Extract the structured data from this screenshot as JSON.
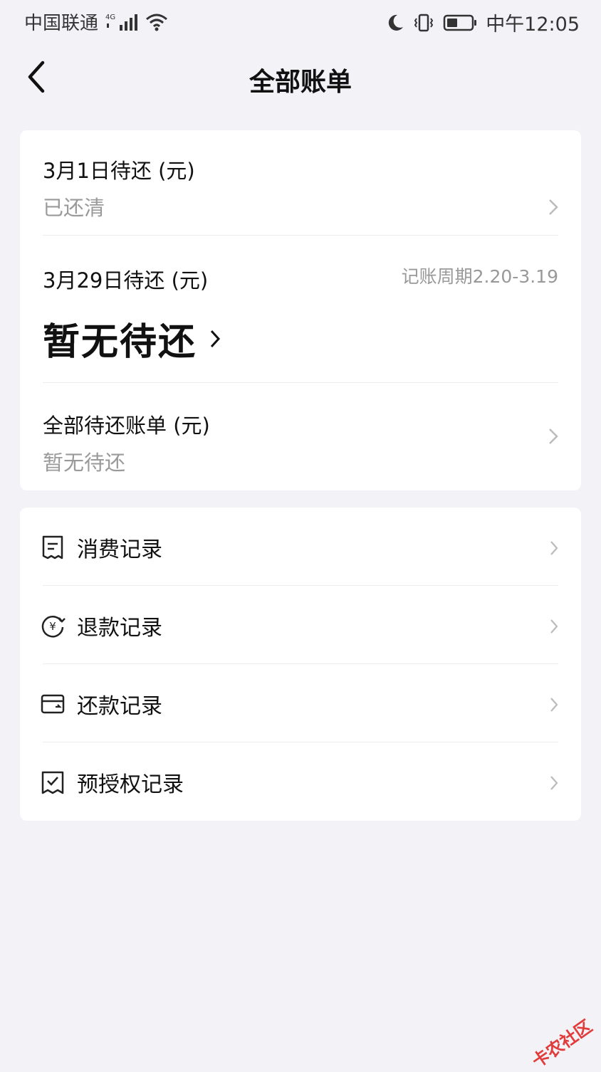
{
  "status_bar": {
    "carrier": "中国联通",
    "network": "4G",
    "time": "中午12:05"
  },
  "header": {
    "title": "全部账单"
  },
  "bills": {
    "current": {
      "label": "3月1日待还 (元)",
      "status": "已还清"
    },
    "next": {
      "label": "3月29日待还 (元)",
      "cycle": "记账周期2.20-3.19",
      "amount_text": "暂无待还"
    },
    "all": {
      "label": "全部待还账单 (元)",
      "status": "暂无待还"
    }
  },
  "records": {
    "items": [
      {
        "label": "消费记录",
        "icon": "receipt-icon"
      },
      {
        "label": "退款记录",
        "icon": "refund-icon"
      },
      {
        "label": "还款记录",
        "icon": "repay-card-icon"
      },
      {
        "label": "预授权记录",
        "icon": "preauth-check-icon"
      }
    ]
  },
  "watermark": {
    "text": "卡农社区"
  }
}
